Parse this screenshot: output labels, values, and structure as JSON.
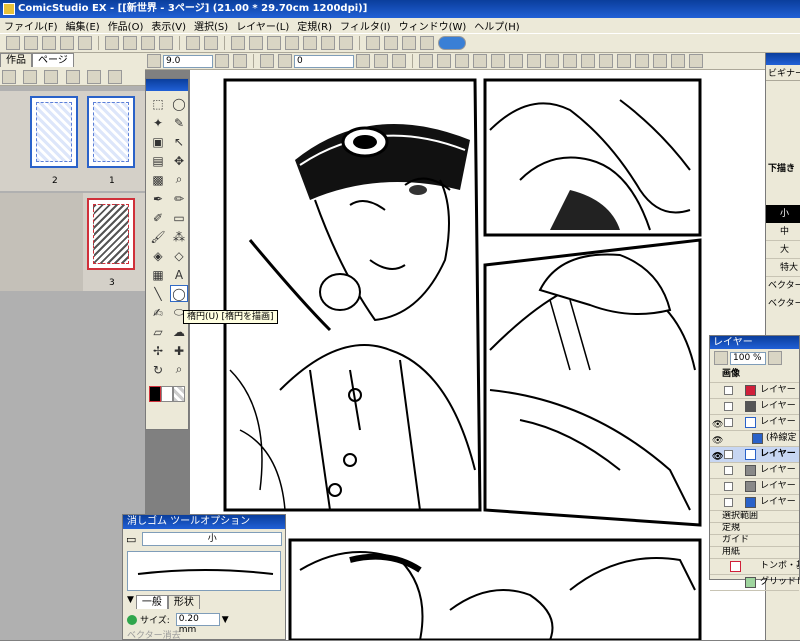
{
  "window": {
    "title": "ComicStudio EX - [[新世界 - 3ページ] (21.00 * 29.70cm 1200dpi)]"
  },
  "menu": [
    "ファイル(F)",
    "編集(E)",
    "作品(O)",
    "表示(V)",
    "選択(S)",
    "レイヤー(L)",
    "定規(R)",
    "フィルタ(I)",
    "ウィンドウ(W)",
    "ヘルプ(H)"
  ],
  "tabs": {
    "works": "作品",
    "pages": "ページ"
  },
  "toolbar2": {
    "zoom_value": "9.0",
    "angle_value": "0"
  },
  "pages": [
    {
      "label": "2"
    },
    {
      "label": "1"
    },
    {
      "label": "3"
    }
  ],
  "tooltip": "楕円(U) [楕円を描画]",
  "eraser_panel": {
    "title": "消しゴム ツールオプション",
    "brush_size_label": "小",
    "tab_general": "一般",
    "tab_shape": "形状",
    "size_label": "サイズ:",
    "size_value": "0.20 mm",
    "vector_label": "ベクター消去"
  },
  "right_panel": {
    "navigator_label": "ビギナー",
    "sketch_label": "下描き",
    "sizes": [
      "小",
      "中",
      "大",
      "特大"
    ],
    "vector_labels": [
      "ベクター",
      "ベクター"
    ]
  },
  "layers_panel": {
    "title": "レイヤー",
    "opacity": "100 %",
    "group_label": "画像",
    "layers": [
      {
        "name": "レイヤー",
        "color": "#d0203a"
      },
      {
        "name": "レイヤー",
        "color": "#555555"
      },
      {
        "name": "レイヤー",
        "color": "#2a62c9"
      },
      {
        "name": "(枠線定",
        "color": "#2a62c9"
      },
      {
        "name": "レイヤー",
        "color": "#2a62c9",
        "selected": true
      },
      {
        "name": "レイヤー",
        "color": "#888888"
      },
      {
        "name": "レイヤー",
        "color": "#888888"
      },
      {
        "name": "レイヤー",
        "color": "#2a62c9"
      }
    ],
    "sections": [
      "選択範囲",
      "定規",
      "ガイド",
      "用紙"
    ],
    "paper_layers": [
      "トンボ・基本",
      "グリッドレイ"
    ]
  }
}
